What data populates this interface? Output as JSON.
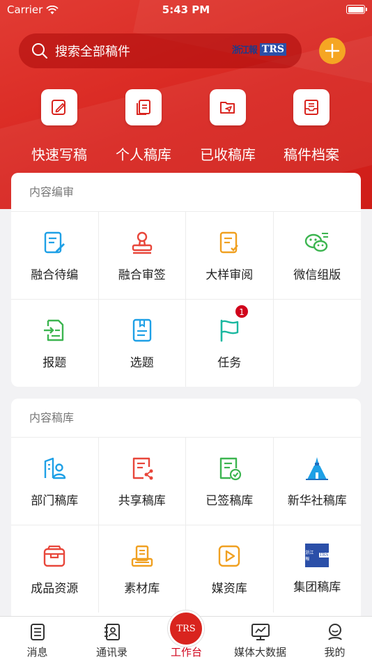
{
  "status": {
    "carrier": "Carrier",
    "time": "5:43 PM"
  },
  "search": {
    "placeholder": "搜索全部稿件",
    "brand_cal": "浙江報",
    "brand_trs": "TRS"
  },
  "quick": [
    {
      "label": "快速写稿",
      "icon": "edit-icon"
    },
    {
      "label": "个人稿库",
      "icon": "documents-icon"
    },
    {
      "label": "已收稿库",
      "icon": "folder-icon"
    },
    {
      "label": "稿件档案",
      "icon": "archive-icon"
    }
  ],
  "section1": {
    "title": "内容编审",
    "items": [
      {
        "label": "融合待编",
        "icon": "edit-doc-icon",
        "color": "#1ea0e6"
      },
      {
        "label": "融合审签",
        "icon": "stamp-icon",
        "color": "#e8463a"
      },
      {
        "label": "大样审阅",
        "icon": "review-icon",
        "color": "#f0a020"
      },
      {
        "label": "微信组版",
        "icon": "wechat-icon",
        "color": "#3cb550"
      },
      {
        "label": "报题",
        "icon": "report-icon",
        "color": "#3cb550"
      },
      {
        "label": "选题",
        "icon": "topic-icon",
        "color": "#1ea0e6"
      },
      {
        "label": "任务",
        "icon": "flag-icon",
        "color": "#1bb8a0",
        "badge": "1"
      }
    ]
  },
  "section2": {
    "title": "内容稿库",
    "items": [
      {
        "label": "部门稿库",
        "icon": "department-icon",
        "color": "#1ea0e6"
      },
      {
        "label": "共享稿库",
        "icon": "share-doc-icon",
        "color": "#e8463a"
      },
      {
        "label": "已签稿库",
        "icon": "signed-doc-icon",
        "color": "#3cb550"
      },
      {
        "label": "新华社稿库",
        "icon": "xinhua-icon",
        "color": "#1ea0e6"
      },
      {
        "label": "成品资源",
        "icon": "box-icon",
        "color": "#e8463a"
      },
      {
        "label": "素材库",
        "icon": "material-icon",
        "color": "#f0a020"
      },
      {
        "label": "媒资库",
        "icon": "media-icon",
        "color": "#f0a020"
      },
      {
        "label": "集团稿库",
        "icon": "group-logo-icon",
        "color": "#2b4fa8"
      }
    ]
  },
  "tabbar": {
    "items": [
      {
        "label": "消息",
        "icon": "message-icon"
      },
      {
        "label": "通讯录",
        "icon": "contacts-icon"
      },
      {
        "label": "工作台",
        "icon": "workbench-icon"
      },
      {
        "label": "媒体大数据",
        "icon": "monitor-icon"
      },
      {
        "label": "我的",
        "icon": "profile-icon"
      }
    ],
    "center": "TRS"
  },
  "colors": {
    "brand_red": "#d9241e",
    "accent_orange": "#f5a623",
    "active_tab": "#d0021b"
  }
}
